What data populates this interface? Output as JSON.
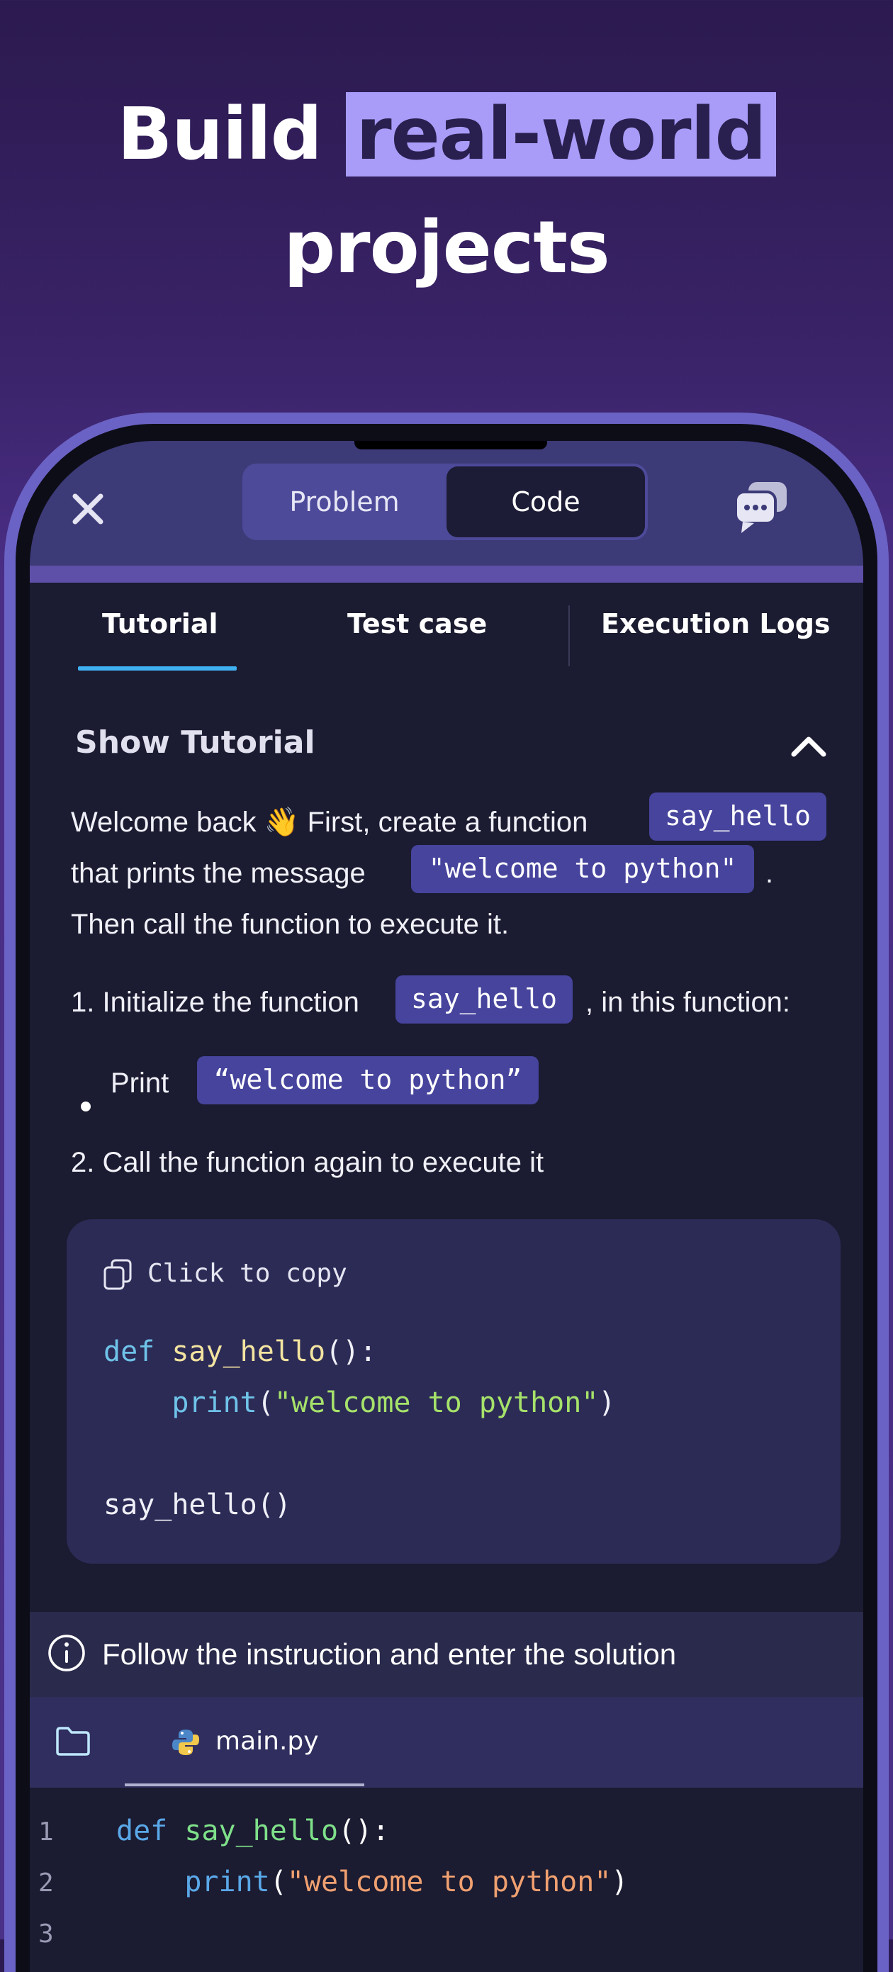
{
  "headline": {
    "line1_prefix": "Build",
    "line1_highlight": "real-world",
    "line2": "projects"
  },
  "header": {
    "segments": [
      "Problem",
      "Code"
    ],
    "selected": "Code"
  },
  "tabs": [
    "Tutorial",
    "Test case",
    "Execution Logs"
  ],
  "active_tab": "Tutorial",
  "tutorial": {
    "toggle_label": "Show Tutorial",
    "p1_a": "Welcome back 👋 First, create a function",
    "p1_chip1": "say_hello",
    "p1_b": "that prints the message",
    "p1_chip2": "\"welcome to python\"",
    "p1_c": ".",
    "p1_d": "Then call the function to execute it.",
    "step1_a": "1. Initialize the function",
    "step1_chip": "say_hello",
    "step1_b": ", in this function:",
    "bullet_a": "Print",
    "bullet_chip": "“welcome to python”",
    "step2": "2. Call the function again to execute it"
  },
  "code_card": {
    "copy_label": "Click to copy",
    "l1_kw": "def",
    "l1_fn": "say_hello",
    "l1_rest": "():",
    "l2_indent": "    ",
    "l2_bi": "print",
    "l2_open": "(",
    "l2_str": "\"welcome to python\"",
    "l2_close": ")",
    "l4": "say_hello()"
  },
  "instruction": "Follow the instruction and enter the solution",
  "file": {
    "name": "main.py"
  },
  "editor": {
    "line_numbers": [
      "1",
      "2",
      "3"
    ],
    "l1_kw": "def",
    "l1_fn": "say_hello",
    "l1_rest": "():",
    "l2_indent": "    ",
    "l2_bi": "print",
    "l2_open": "(",
    "l2_str": "\"welcome to python\"",
    "l2_close": ")"
  },
  "colors": {
    "accent_highlight": "#a99cf8",
    "chip": "#46449c",
    "tab_underline": "#3fb0f0",
    "screen_bg": "#1b1b31"
  },
  "icons": [
    "close-icon",
    "chat-icon",
    "chevron-up-icon",
    "copy-icon",
    "info-icon",
    "folder-icon",
    "python-icon"
  ]
}
